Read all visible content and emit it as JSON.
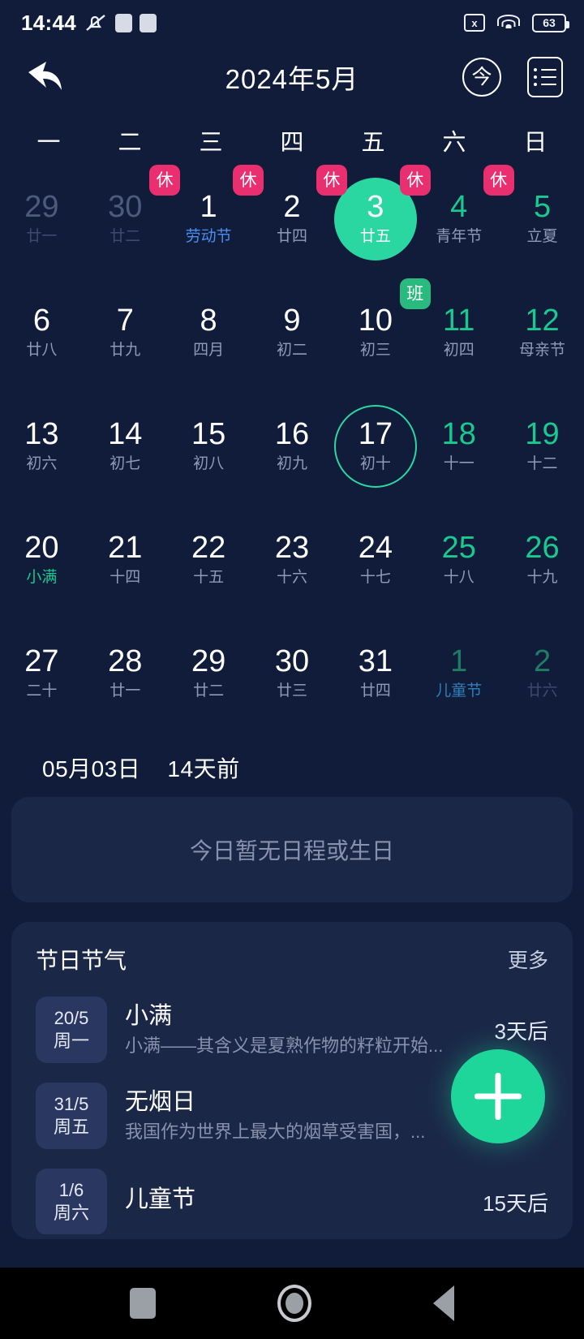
{
  "status_bar": {
    "time": "14:44",
    "mute_icon": "mute-bell-icon",
    "sim_icon": "sim-x-icon",
    "sim_glyph": "x",
    "wifi_icon": "wifi-icon",
    "battery_icon": "battery-icon",
    "battery_level": "63"
  },
  "app_bar": {
    "back_icon": "back-arrow-icon",
    "title": "2024年5月",
    "today_button": "今",
    "list_icon": "list-view-icon"
  },
  "weekdays": [
    "一",
    "二",
    "三",
    "四",
    "五",
    "六",
    "日"
  ],
  "calendar": {
    "weeks": [
      [
        {
          "day": "29",
          "lunar": "廿一",
          "style": "c-dim"
        },
        {
          "day": "30",
          "lunar": "廿二",
          "style": "c-dim"
        },
        {
          "day": "1",
          "lunar": "劳动节",
          "style": "c-white",
          "lunar_color": "sub-blue",
          "badge": "休",
          "badge_type": "rest"
        },
        {
          "day": "2",
          "lunar": "廿四",
          "style": "c-white",
          "badge": "休",
          "badge_type": "rest"
        },
        {
          "day": "3",
          "lunar": "廿五",
          "style": "c-white",
          "badge": "休",
          "badge_type": "rest",
          "selected": true
        },
        {
          "day": "4",
          "lunar": "青年节",
          "style": "c-green",
          "badge": "休",
          "badge_type": "rest"
        },
        {
          "day": "5",
          "lunar": "立夏",
          "style": "c-green",
          "badge": "休",
          "badge_type": "rest"
        }
      ],
      [
        {
          "day": "6",
          "lunar": "廿八",
          "style": "c-white"
        },
        {
          "day": "7",
          "lunar": "廿九",
          "style": "c-white"
        },
        {
          "day": "8",
          "lunar": "四月",
          "style": "c-white"
        },
        {
          "day": "9",
          "lunar": "初二",
          "style": "c-white"
        },
        {
          "day": "10",
          "lunar": "初三",
          "style": "c-white"
        },
        {
          "day": "11",
          "lunar": "初四",
          "style": "c-green",
          "badge": "班",
          "badge_type": "work"
        },
        {
          "day": "12",
          "lunar": "母亲节",
          "style": "c-green"
        }
      ],
      [
        {
          "day": "13",
          "lunar": "初六",
          "style": "c-white"
        },
        {
          "day": "14",
          "lunar": "初七",
          "style": "c-white"
        },
        {
          "day": "15",
          "lunar": "初八",
          "style": "c-white"
        },
        {
          "day": "16",
          "lunar": "初九",
          "style": "c-white"
        },
        {
          "day": "17",
          "lunar": "初十",
          "style": "c-white",
          "today": true
        },
        {
          "day": "18",
          "lunar": "十一",
          "style": "c-green"
        },
        {
          "day": "19",
          "lunar": "十二",
          "style": "c-green"
        }
      ],
      [
        {
          "day": "20",
          "lunar": "小满",
          "style": "c-white",
          "lunar_color": "sub-green"
        },
        {
          "day": "21",
          "lunar": "十四",
          "style": "c-white"
        },
        {
          "day": "22",
          "lunar": "十五",
          "style": "c-white"
        },
        {
          "day": "23",
          "lunar": "十六",
          "style": "c-white"
        },
        {
          "day": "24",
          "lunar": "十七",
          "style": "c-white"
        },
        {
          "day": "25",
          "lunar": "十八",
          "style": "c-green"
        },
        {
          "day": "26",
          "lunar": "十九",
          "style": "c-green"
        }
      ],
      [
        {
          "day": "27",
          "lunar": "二十",
          "style": "c-white"
        },
        {
          "day": "28",
          "lunar": "廿一",
          "style": "c-white"
        },
        {
          "day": "29",
          "lunar": "廿二",
          "style": "c-white"
        },
        {
          "day": "30",
          "lunar": "廿三",
          "style": "c-white"
        },
        {
          "day": "31",
          "lunar": "廿四",
          "style": "c-white"
        },
        {
          "day": "1",
          "lunar": "儿童节",
          "style": "c-dimg",
          "lunar_color": "sub-teal"
        },
        {
          "day": "2",
          "lunar": "廿六",
          "style": "c-dimg"
        }
      ]
    ]
  },
  "schedule": {
    "date_label": "05月03日",
    "relative_label": "14天前",
    "empty_text": "今日暂无日程或生日"
  },
  "festivals": {
    "title": "节日节气",
    "more_label": "更多",
    "items": [
      {
        "date": "20/5",
        "weekday": "周一",
        "name": "小满",
        "description": "小满——其含义是夏熟作物的籽粒开始...",
        "when": "3天后"
      },
      {
        "date": "31/5",
        "weekday": "周五",
        "name": "无烟日",
        "description": "我国作为世界上最大的烟草受害国，...",
        "when": ""
      },
      {
        "date": "1/6",
        "weekday": "周六",
        "name": "儿童节",
        "description": "",
        "when": "15天后"
      }
    ]
  },
  "fab": {
    "icon": "plus-icon"
  },
  "nav_bar": {
    "recents_icon": "recents-square-icon",
    "home_icon": "home-circle-icon",
    "back_icon": "back-triangle-icon"
  },
  "colors": {
    "background": "#111c3a",
    "card": "#1b2747",
    "accent_green": "#1ed69a",
    "badge_rest": "#ea2f70",
    "badge_work": "#2ab97f",
    "text_muted": "#8892ad"
  }
}
